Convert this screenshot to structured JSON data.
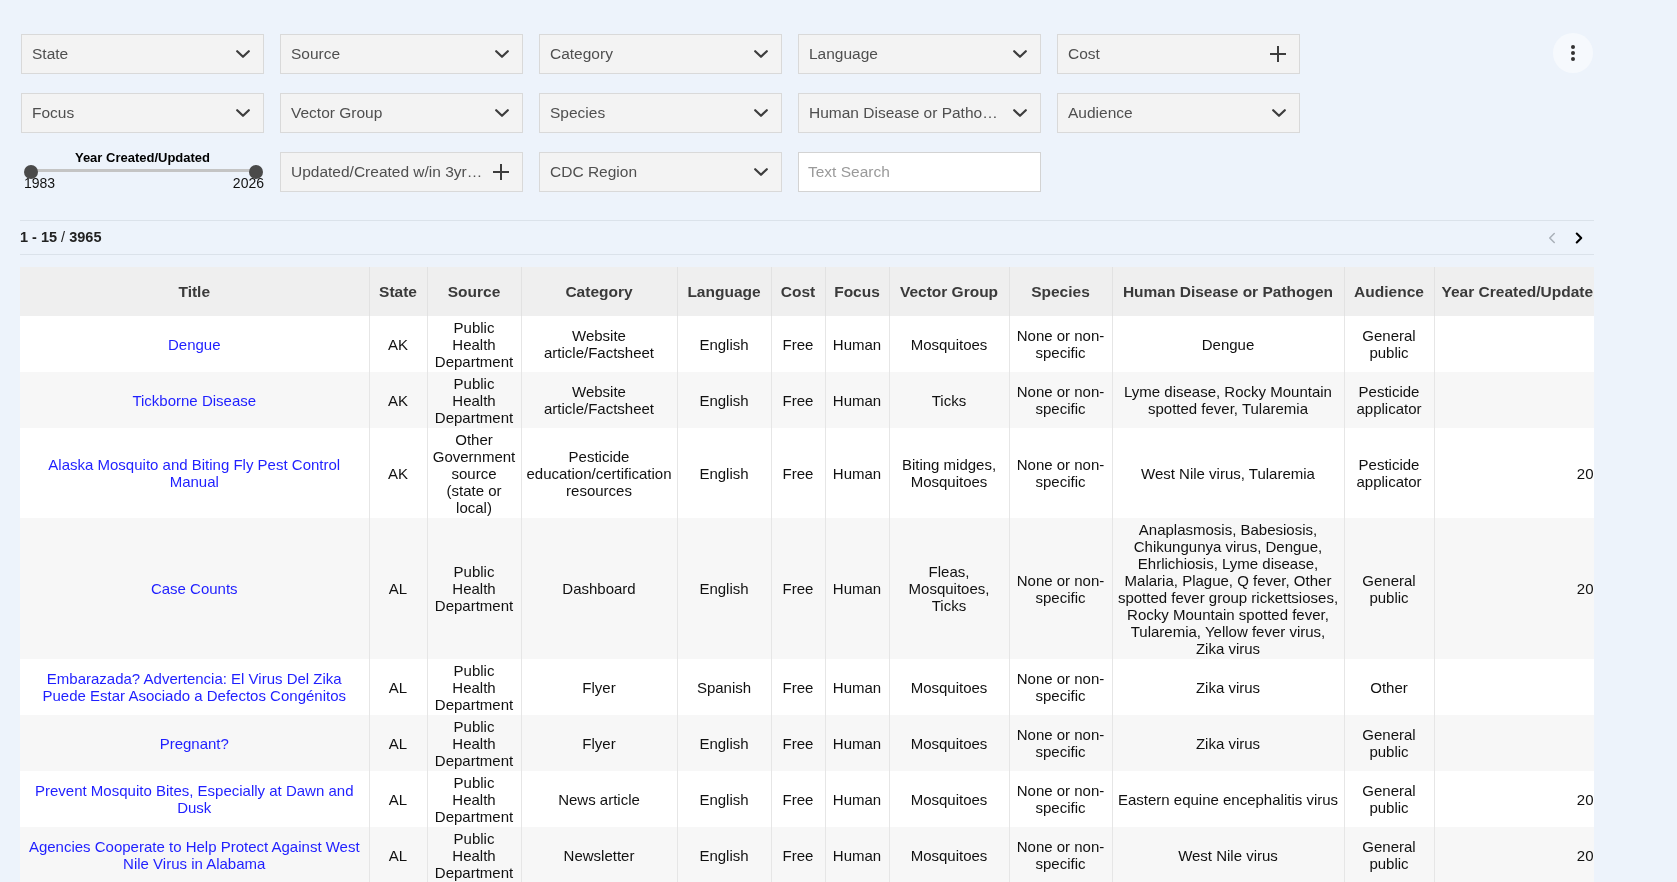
{
  "filter_rows": [
    [
      {
        "kind": "dropdown",
        "label": "State"
      },
      {
        "kind": "dropdown",
        "label": "Source"
      },
      {
        "kind": "dropdown",
        "label": "Category"
      },
      {
        "kind": "dropdown",
        "label": "Language"
      },
      {
        "kind": "toggle",
        "label": "Cost"
      }
    ],
    [
      {
        "kind": "dropdown",
        "label": "Focus"
      },
      {
        "kind": "dropdown",
        "label": "Vector Group"
      },
      {
        "kind": "dropdown",
        "label": "Species"
      },
      {
        "kind": "dropdown",
        "label": "Human Disease or Patho…"
      },
      {
        "kind": "dropdown",
        "label": "Audience"
      }
    ],
    [
      {
        "kind": "range",
        "title": "Year Created/Updated",
        "min_label": "1983",
        "max_label": "2026",
        "thumbs": [
          {
            "level": 0
          },
          {
            "level": 1
          }
        ]
      },
      {
        "kind": "toggle",
        "label": "Updated/Created w/in 3yr…"
      },
      {
        "kind": "dropdown",
        "label": "CDC Region"
      },
      {
        "kind": "search",
        "placeholder": "Text Search"
      }
    ]
  ],
  "pagination": {
    "range": "**1 - 15** / **3965**",
    "previous": {
      "disabled": true
    },
    "next": {
      "disabled": false
    }
  },
  "table": {
    "columns": [
      {
        "label": "Title",
        "kind": "link"
      },
      {
        "label": "State",
        "kind": "text"
      },
      {
        "label": "Source",
        "kind": "text"
      },
      {
        "label": "Category",
        "kind": "text"
      },
      {
        "label": "Language",
        "kind": "text"
      },
      {
        "label": "Cost",
        "kind": "text"
      },
      {
        "label": "Focus",
        "kind": "text"
      },
      {
        "label": "Vector Group",
        "kind": "text"
      },
      {
        "label": "Species",
        "kind": "text"
      },
      {
        "label": "Human Disease or Pathogen",
        "kind": "text"
      },
      {
        "label": "Audience",
        "kind": "text"
      },
      {
        "label": "Year Created/Update",
        "kind": "number"
      }
    ],
    "rows": [
      {
        "cells": [
          "Dengue",
          "AK",
          "Public Health Department",
          "Website article/Factsheet",
          "English",
          "Free",
          "Human",
          "Mosquitoes",
          "None or non-specific",
          "Dengue",
          "General public"
        ]
      },
      {
        "cells": [
          "Tickborne Disease",
          "AK",
          "Public Health Department",
          "Website article/Factsheet",
          "English",
          "Free",
          "Human",
          "Ticks",
          "None or non-specific",
          "Lyme disease, Rocky Mountain spotted fever, Tularemia",
          "Pesticide applicator"
        ]
      },
      {
        "cells": [
          "Alaska Mosquito and Biting Fly Pest Control Manual",
          "AK",
          "Other Government source (state or local)",
          "Pesticide education/certification resources",
          "English",
          "Free",
          "Human",
          "Biting midges, Mosquitoes",
          "None or non-specific",
          "West Nile virus, Tularemia",
          "Pesticide applicator",
          "20"
        ]
      },
      {
        "cells": [
          "Case Counts",
          "AL",
          "Public Health Department",
          "Dashboard",
          "English",
          "Free",
          "Human",
          "Fleas, Mosquitoes, Ticks",
          "None or non-specific",
          "Anaplasmosis, Babesiosis, Chikungunya virus, Dengue, Ehrlichiosis, Lyme disease, Malaria, Plague, Q fever, Other spotted fever group rickettsioses, Rocky Mountain spotted fever, Tularemia, Yellow fever virus, Zika virus",
          "General public",
          "20"
        ]
      },
      {
        "cells": [
          "Embarazada? Advertencia: El Virus Del Zika Puede Estar Asociado a Defectos Congénitos",
          "AL",
          "Public Health Department",
          "Flyer",
          "Spanish",
          "Free",
          "Human",
          "Mosquitoes",
          "None or non-specific",
          "Zika virus",
          "Other"
        ]
      },
      {
        "cells": [
          "Pregnant?",
          "AL",
          "Public Health Department",
          "Flyer",
          "English",
          "Free",
          "Human",
          "Mosquitoes",
          "None or non-specific",
          "Zika virus",
          "General public"
        ]
      },
      {
        "cells": [
          "Prevent Mosquito Bites, Especially at Dawn and Dusk",
          "AL",
          "Public Health Department",
          "News article",
          "English",
          "Free",
          "Human",
          "Mosquitoes",
          "None or non-specific",
          "Eastern equine encephalitis virus",
          "General public",
          "20"
        ]
      },
      {
        "cells": [
          "Agencies Cooperate to Help Protect Against West Nile Virus in Alabama",
          "AL",
          "Public Health Department",
          "Newsletter",
          "English",
          "Free",
          "Human",
          "Mosquitoes",
          "None or non-specific",
          "West Nile virus",
          "General public",
          "20"
        ]
      }
    ]
  }
}
